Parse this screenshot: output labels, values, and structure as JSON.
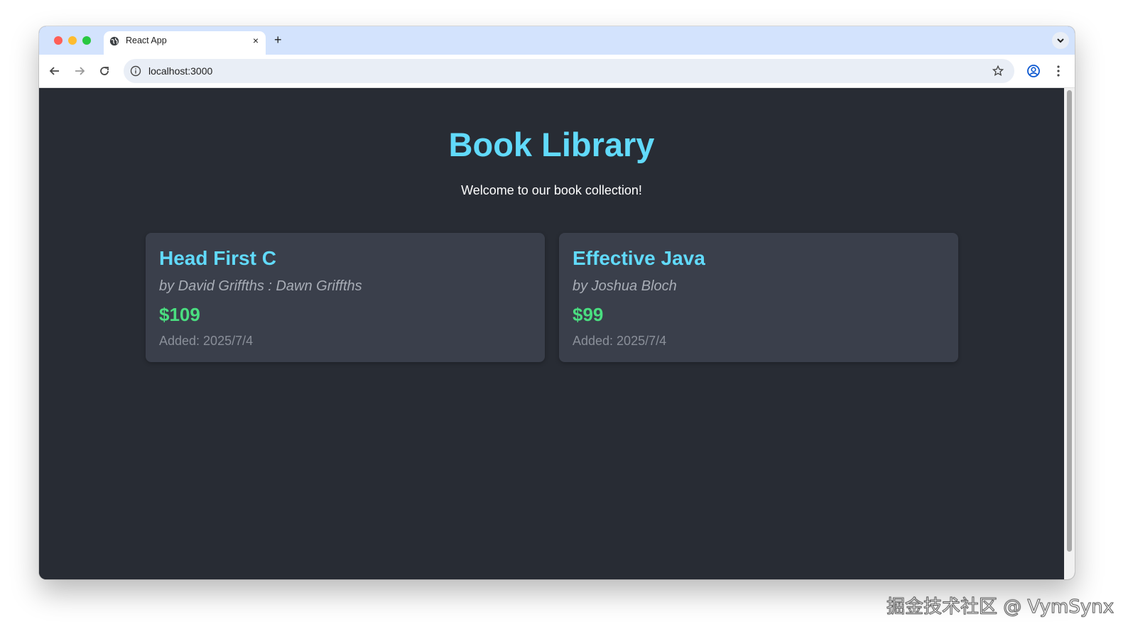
{
  "browser": {
    "tab": {
      "title": "React App",
      "close_glyph": "×",
      "icon": "globe-icon"
    },
    "new_tab_glyph": "+",
    "address_bar": {
      "url": "localhost:3000"
    }
  },
  "page": {
    "title": "Book Library",
    "subtitle": "Welcome to our book collection!",
    "books": [
      {
        "title": "Head First C",
        "author": "by David Griffths : Dawn Griffths",
        "price": "$109",
        "added": "Added: 2025/7/4"
      },
      {
        "title": "Effective Java",
        "author": "by Joshua Bloch",
        "price": "$99",
        "added": "Added: 2025/7/4"
      }
    ]
  },
  "watermark": "掘金技术社区 @ VymSynx",
  "colors": {
    "accent": "#61dafb",
    "price": "#4ade80",
    "background": "#282c34",
    "card": "#3a3f4b"
  }
}
